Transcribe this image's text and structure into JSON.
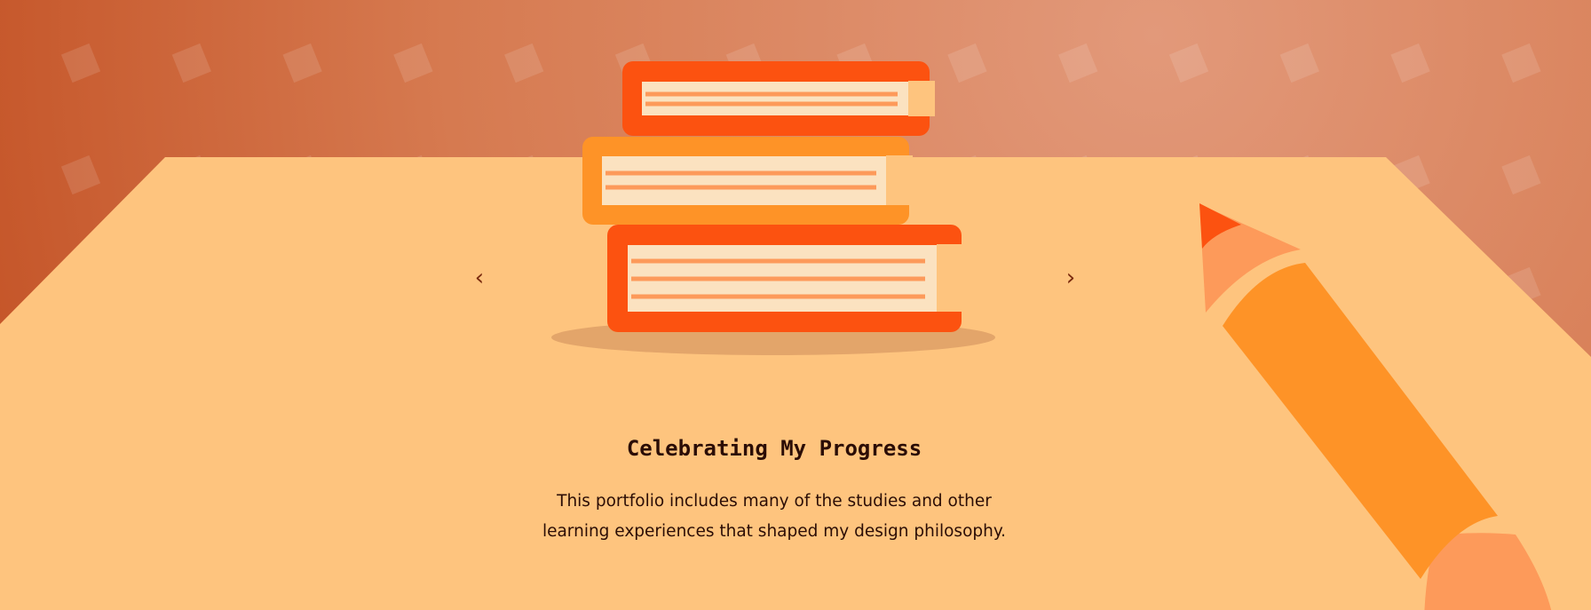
{
  "slide": {
    "title": "Celebrating My Progress",
    "description": "This portfolio includes many of the studies and other learning experiences that shaped my design philosophy."
  },
  "carousel": {
    "prev_glyph": "‹",
    "next_glyph": "›",
    "prev_icon": "chevron-left-icon",
    "next_icon": "chevron-right-icon"
  },
  "illustration": {
    "subject": "stack-of-books-icon",
    "accessory": "pencil-icon"
  },
  "colors": {
    "background_top": "#c9562a",
    "background_glow": "#e2997a",
    "table": "#fec47e",
    "book_red": "#fc5210",
    "book_orange": "#fe9327",
    "pages": "#fbe2c0",
    "page_lines": "#fd9a5a",
    "shadow": "#e3a56a",
    "text": "#2b0d06",
    "chevron": "#7a2a0e"
  }
}
